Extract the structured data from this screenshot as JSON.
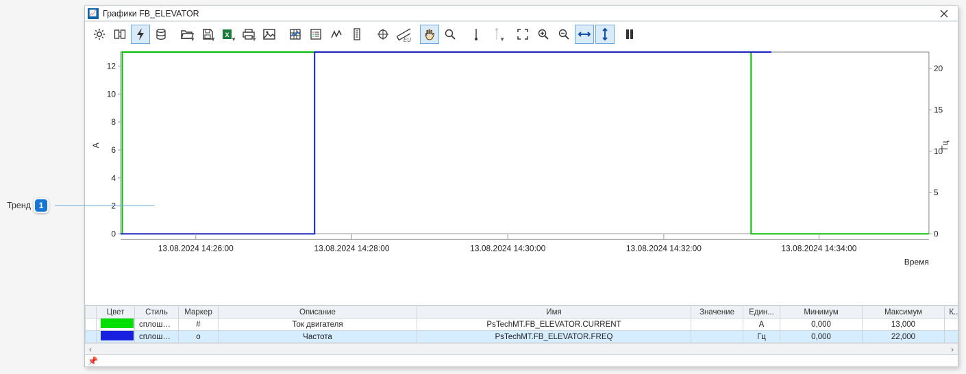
{
  "window": {
    "title": "Графики FB_ELEVATOR"
  },
  "annotation": {
    "label": "Тренд",
    "number": "1"
  },
  "chart_data": {
    "type": "line",
    "xlabel": "Время",
    "x_axis": {
      "ticks": [
        "13.08.2024 14:26:00",
        "13.08.2024 14:28:00",
        "13.08.2024 14:30:00",
        "13.08.2024 14:32:00",
        "13.08.2024 14:34:00"
      ],
      "range_fraction": [
        0.093,
        0.286,
        0.479,
        0.672,
        0.864
      ]
    },
    "y_left": {
      "label": "A",
      "color": "#00c000",
      "min": 0,
      "max": 13,
      "ticks": [
        0,
        2,
        4,
        6,
        8,
        10,
        12
      ]
    },
    "y_right": {
      "label": "Гц",
      "color": "#1820c0",
      "min": 0,
      "max": 22,
      "ticks": [
        0,
        5,
        10,
        15,
        20
      ]
    },
    "series": [
      {
        "name": "Ток двигателя",
        "tag": "PsTechMT.FB_ELEVATOR.CURRENT",
        "axis": "left",
        "color": "#00c000",
        "x_frac": [
          0.0,
          0.002,
          0.002,
          0.78,
          0.78,
          1.0
        ],
        "y": [
          0,
          0,
          13,
          13,
          0,
          0
        ]
      },
      {
        "name": "Частота",
        "tag": "PsTechMT.FB_ELEVATOR.FREQ",
        "axis": "right",
        "color": "#1820c0",
        "x_frac": [
          0.0,
          0.24,
          0.24,
          0.805,
          0.805
        ],
        "y": [
          0,
          0,
          22,
          22,
          22
        ]
      }
    ]
  },
  "table": {
    "columns": [
      "Цвет",
      "Стиль",
      "Маркер",
      "Описание",
      "Имя",
      "Значение",
      "Един...",
      "Минимум",
      "Максимум",
      "К..."
    ],
    "rows": [
      {
        "color": "#00e000",
        "style": "сплошная",
        "marker": "#",
        "desc": "Ток двигателя",
        "name": "PsTechMT.FB_ELEVATOR.CURRENT",
        "value": "",
        "unit": "А",
        "min": "0,000",
        "max": "13,000",
        "selected": false
      },
      {
        "color": "#1820e0",
        "style": "сплошная",
        "marker": "o",
        "desc": "Частота",
        "name": "PsTechMT.FB_ELEVATOR.FREQ",
        "value": "",
        "unit": "Гц",
        "min": "0,000",
        "max": "22,000",
        "selected": true
      }
    ]
  }
}
